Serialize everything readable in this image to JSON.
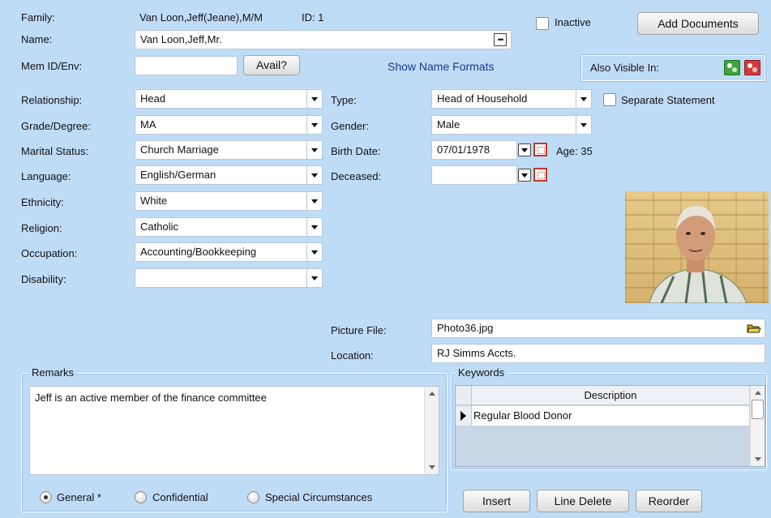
{
  "header": {
    "family_label": "Family:",
    "family_value": "Van Loon,Jeff(Jeane),M/M",
    "id_text": "ID: 1",
    "inactive_label": "Inactive",
    "add_documents_label": "Add Documents"
  },
  "name": {
    "label": "Name:",
    "value": "Van Loon,Jeff,Mr."
  },
  "mem_id": {
    "label": "Mem ID/Env:",
    "value": "",
    "avail_label": "Avail?",
    "show_formats_label": "Show Name Formats"
  },
  "also_visible": {
    "label": "Also Visible In:"
  },
  "left_fields": {
    "relationship": {
      "label": "Relationship:",
      "value": "Head"
    },
    "grade": {
      "label": "Grade/Degree:",
      "value": "MA"
    },
    "marital": {
      "label": "Marital Status:",
      "value": "Church Marriage"
    },
    "language": {
      "label": "Language:",
      "value": "English/German"
    },
    "ethnicity": {
      "label": "Ethnicity:",
      "value": "White"
    },
    "religion": {
      "label": "Religion:",
      "value": "Catholic"
    },
    "occupation": {
      "label": "Occupation:",
      "value": "Accounting/Bookkeeping"
    },
    "disability": {
      "label": "Disability:",
      "value": ""
    }
  },
  "right_fields": {
    "type": {
      "label": "Type:",
      "value": "Head of Household"
    },
    "separate_statement_label": "Separate Statement",
    "gender": {
      "label": "Gender:",
      "value": "Male"
    },
    "birth_date": {
      "label": "Birth Date:",
      "value": "07/01/1978",
      "age_text": "Age: 35"
    },
    "deceased": {
      "label": "Deceased:",
      "value": ""
    }
  },
  "picture": {
    "file_label": "Picture File:",
    "file_value": "Photo36.jpg",
    "location_label": "Location:",
    "location_value": "RJ Simms Accts."
  },
  "remarks": {
    "title": "Remarks",
    "text": "Jeff is an active member of the finance committee",
    "radios": [
      {
        "label": "General *",
        "selected": true
      },
      {
        "label": "Confidential",
        "selected": false
      },
      {
        "label": "Special Circumstances",
        "selected": false
      }
    ]
  },
  "keywords": {
    "title": "Keywords",
    "column_header": "Description",
    "rows": [
      "Regular Blood Donor"
    ],
    "buttons": {
      "insert": "Insert",
      "line_delete": "Line Delete",
      "reorder": "Reorder"
    }
  },
  "colors": {
    "background": "#bfdcf7",
    "link": "#1a3a8a",
    "accent_green": "#3fa33f",
    "accent_red": "#d23b3b"
  }
}
